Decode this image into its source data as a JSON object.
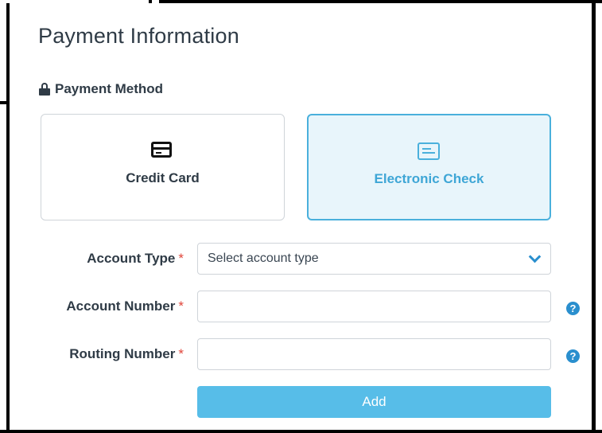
{
  "page_title": "Payment Information",
  "payment_method": {
    "label": "Payment Method",
    "options": [
      {
        "label": "Credit Card",
        "selected": false
      },
      {
        "label": "Electronic Check",
        "selected": true
      }
    ]
  },
  "fields": {
    "account_type": {
      "label": "Account Type",
      "required": "*",
      "placeholder": "Select account type"
    },
    "account_number": {
      "label": "Account Number",
      "required": "*",
      "value": ""
    },
    "routing_number": {
      "label": "Routing Number",
      "required": "*",
      "value": ""
    }
  },
  "help_glyph": "?",
  "add_label": "Add",
  "colors": {
    "accent": "#4ab0dc",
    "button": "#57bde8",
    "required": "#e0453a",
    "text": "#2f3b46"
  }
}
